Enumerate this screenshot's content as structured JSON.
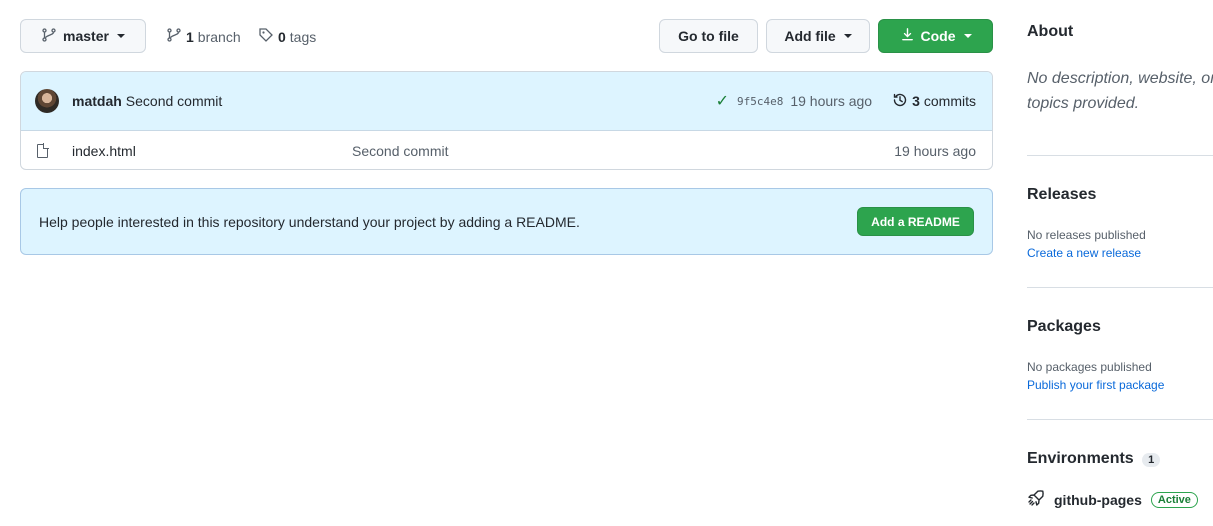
{
  "toolbar": {
    "branch_label": "master",
    "branch_count": "1",
    "branch_word": "branch",
    "tag_count": "0",
    "tag_word": "tags",
    "goto_file": "Go to file",
    "add_file": "Add file",
    "code": "Code"
  },
  "latest_commit": {
    "author": "matdah",
    "message": "Second commit",
    "sha": "9f5c4e8",
    "time": "19 hours ago",
    "commits_count": "3",
    "commits_word": "commits"
  },
  "files": [
    {
      "name": "index.html",
      "commit": "Second commit",
      "time": "19 hours ago"
    }
  ],
  "readme": {
    "text": "Help people interested in this repository understand your project by adding a README.",
    "button": "Add a README"
  },
  "sidebar": {
    "about_title": "About",
    "about_desc": "No description, website, or topics provided.",
    "releases_title": "Releases",
    "releases_text": "No releases published",
    "releases_link": "Create a new release",
    "packages_title": "Packages",
    "packages_text": "No packages published",
    "packages_link": "Publish your first package",
    "environments_title": "Environments",
    "environments_count": "1",
    "environment_name": "github-pages",
    "environment_status": "Active"
  },
  "colors": {
    "green": "#2da44e",
    "blue_bg": "#ddf4ff",
    "link": "#0969da"
  }
}
